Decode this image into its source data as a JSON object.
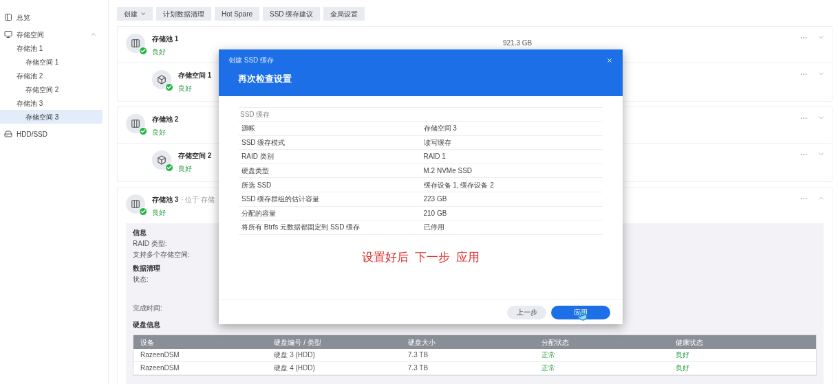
{
  "sidebar": {
    "items": [
      {
        "label": "总览",
        "selected": false
      },
      {
        "label": "存储空间",
        "selected": false,
        "expanded": true,
        "children": [
          {
            "label": "存储池 1",
            "selected": false,
            "children": [
              {
                "label": "存储空间 1",
                "selected": false
              }
            ]
          },
          {
            "label": "存储池 2",
            "selected": false,
            "children": [
              {
                "label": "存储空间 2",
                "selected": false
              }
            ]
          },
          {
            "label": "存储池 3",
            "selected": false,
            "children": [
              {
                "label": "存储空间 3",
                "selected": true
              }
            ]
          }
        ]
      },
      {
        "label": "HDD/SSD",
        "selected": false
      }
    ]
  },
  "toolbar": [
    {
      "label": "创建",
      "menu": true
    },
    {
      "label": "计划数据清理",
      "menu": false
    },
    {
      "label": "Hot Spare",
      "menu": false
    },
    {
      "label": "SSD 缓存建议",
      "menu": false
    },
    {
      "label": "全局设置",
      "menu": false
    }
  ],
  "groups": [
    {
      "cards": [
        {
          "kind": "pool",
          "name": "存储池 1",
          "status": "良好",
          "capacity": "921.3 GB",
          "expanded": false
        },
        {
          "kind": "volume",
          "name": "存储空间 1",
          "status": "良好",
          "expanded": false
        }
      ]
    },
    {
      "cards": [
        {
          "kind": "pool",
          "name": "存储池 2",
          "status": "良好",
          "expanded": false
        },
        {
          "kind": "volume",
          "name": "存储空间 2",
          "status": "良好",
          "expanded": false
        }
      ]
    },
    {
      "cards": [
        {
          "kind": "pool",
          "name": "存储池 3",
          "subtitle": "· 位于 存储",
          "status": "良好",
          "expanded": true
        }
      ],
      "details": {
        "sections": [
          {
            "title": "信息",
            "labels": [
              "RAID 类型:",
              "支持多个存储空间:"
            ]
          },
          {
            "title": "数据清理",
            "labels": [
              "状态:",
              "完成时间:"
            ]
          }
        ],
        "disk_title": "硬盘信息",
        "table": {
          "columns": [
            "设备",
            "硬盘编号 / 类型",
            "硬盘大小",
            "分配状态",
            "健康状态"
          ],
          "rows": [
            [
              "RazeenDSM",
              "硬盘 3 (HDD)",
              "7.3 TB",
              "正常",
              "良好"
            ],
            [
              "RazeenDSM",
              "硬盘 4 (HDD)",
              "7.3 TB",
              "正常",
              "良好"
            ]
          ]
        }
      }
    }
  ],
  "dialog": {
    "window_title": "创建 SSD 缓存",
    "heading": "再次检查设置",
    "section": "SSD 缓存",
    "rows": [
      {
        "label": "源帐",
        "value": "存储空间 3"
      },
      {
        "label": "SSD 缓存模式",
        "value": "读写缓存"
      },
      {
        "label": "RAID 类别",
        "value": "RAID 1"
      },
      {
        "label": "硬盘类型",
        "value": "M.2 NVMe SSD"
      },
      {
        "label": "所选 SSD",
        "value": "缓存设备 1, 缓存设备 2"
      },
      {
        "label": "SSD 缓存群组的估计容量",
        "value": "223 GB"
      },
      {
        "label": "分配的容量",
        "value": "210 GB"
      },
      {
        "label": "将所有 Btrfs 元数据都固定到 SSD 缓存",
        "value": "已停用"
      }
    ],
    "annotation": "设置好后  下一步  应用",
    "buttons": [
      {
        "label": "上一步",
        "kind": "secondary"
      },
      {
        "label": "应用",
        "kind": "primary"
      }
    ]
  }
}
